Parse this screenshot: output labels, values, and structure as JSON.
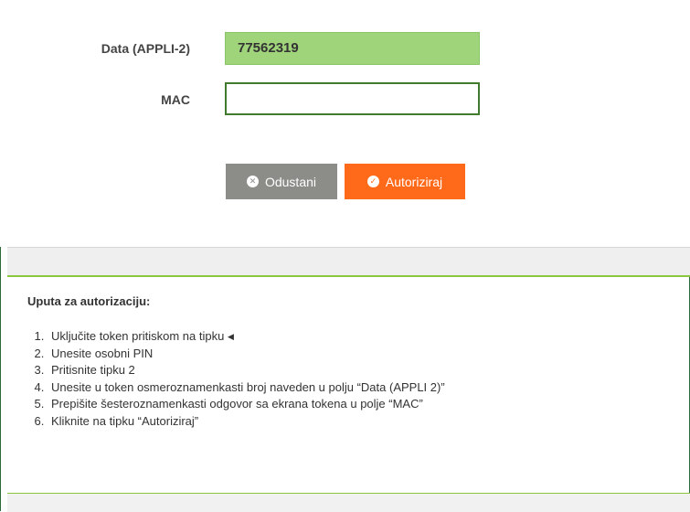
{
  "form": {
    "data_label": "Data (APPLI-2)",
    "data_value": "77562319",
    "mac_label": "MAC",
    "mac_value": ""
  },
  "buttons": {
    "cancel_label": "Odustani",
    "authorize_label": "Autoriziraj",
    "cancel_icon": "x-circle-icon",
    "authorize_icon": "check-circle-icon"
  },
  "instructions": {
    "title": "Uputa za autorizaciju:",
    "steps": [
      "Uključite token pritiskom na tipku",
      "Unesite osobni PIN",
      "Pritisnite tipku 2",
      "Unesite u token osmeroznamenkasti broj naveden u polju “Data (APPLI 2)”",
      "Prepišite šesteroznamenkasti odgovor sa ekrana tokena u polje “MAC”",
      "Kliknite na tipku “Autoriziraj”"
    ],
    "step1_icon": "left-triangle-icon"
  },
  "colors": {
    "data_field_bg": "#9fd47b",
    "cancel_bg": "#8c8c88",
    "authorize_bg": "#ff6a1a",
    "accent_green": "#8cc63f"
  }
}
